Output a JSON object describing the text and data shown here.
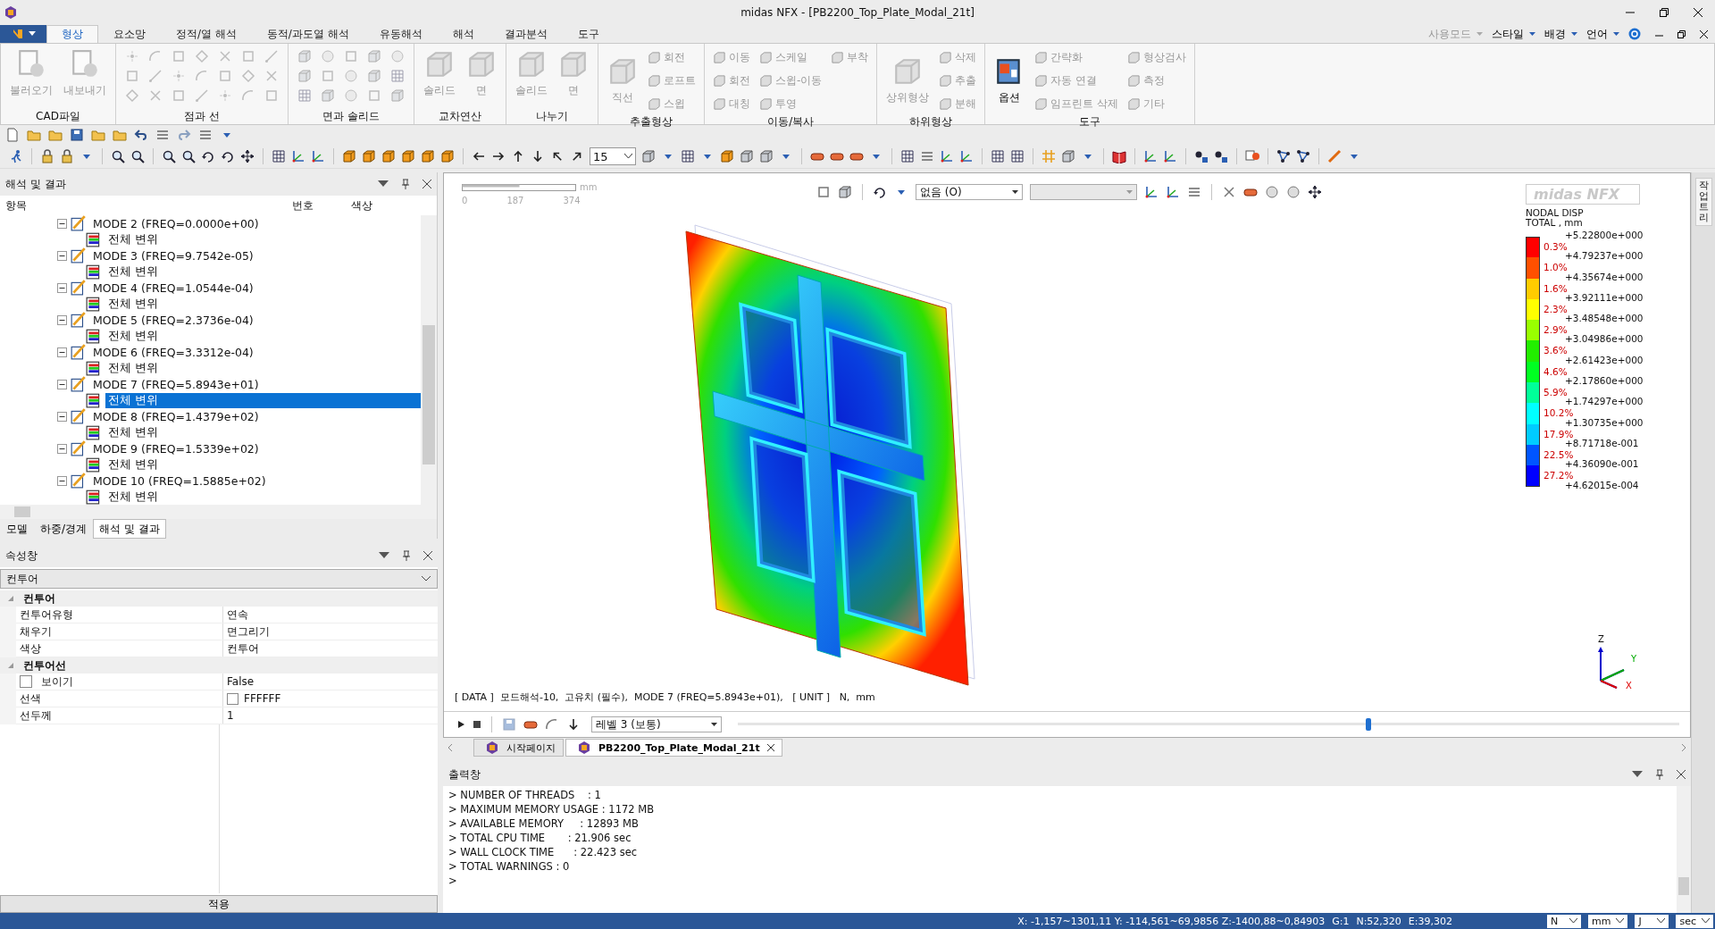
{
  "window": {
    "title": "midas NFX - [PB2200_Top_Plate_Modal_21t]"
  },
  "ribbon_tabs": [
    {
      "label": "형상",
      "selected": true
    },
    {
      "label": "요소망",
      "selected": false
    },
    {
      "label": "정적/열 해석",
      "selected": false
    },
    {
      "label": "동적/과도열 해석",
      "selected": false
    },
    {
      "label": "유동해석",
      "selected": false
    },
    {
      "label": "해석",
      "selected": false
    },
    {
      "label": "결과분석",
      "selected": false
    },
    {
      "label": "도구",
      "selected": false
    }
  ],
  "ribbon_right": [
    {
      "label": "사용모드",
      "disabled": true
    },
    {
      "label": "스타일",
      "disabled": false
    },
    {
      "label": "배경",
      "disabled": false
    },
    {
      "label": "언어",
      "disabled": false
    }
  ],
  "ribbon_groups": [
    {
      "title": "CAD파일",
      "items": [
        {
          "kind": "large",
          "label": "불러오기",
          "disabled": true
        },
        {
          "kind": "large",
          "label": "내보내기",
          "disabled": true
        }
      ]
    },
    {
      "title": "점과 선",
      "items": [
        {
          "kind": "icon_grid",
          "disabled": true
        }
      ]
    },
    {
      "title": "면과 솔리드",
      "items": [
        {
          "kind": "icon_grid",
          "disabled": true
        }
      ]
    },
    {
      "title": "교차연산",
      "items": [
        {
          "kind": "large",
          "label": "솔리드",
          "disabled": true
        },
        {
          "kind": "large",
          "label": "면",
          "disabled": true
        }
      ]
    },
    {
      "title": "나누기",
      "items": [
        {
          "kind": "large",
          "label": "솔리드",
          "disabled": true
        },
        {
          "kind": "large",
          "label": "면",
          "disabled": true
        }
      ]
    },
    {
      "title": "추출형상",
      "items": [
        {
          "kind": "large",
          "label": "직선",
          "disabled": true
        },
        {
          "kind": "small",
          "label": "회전",
          "disabled": true
        },
        {
          "kind": "small",
          "label": "로프트",
          "disabled": true
        },
        {
          "kind": "small",
          "label": "스윕",
          "disabled": true
        }
      ]
    },
    {
      "title": "이동/복사",
      "items": [
        {
          "kind": "small",
          "label": "이동",
          "disabled": true
        },
        {
          "kind": "small",
          "label": "회전",
          "disabled": true
        },
        {
          "kind": "small",
          "label": "대칭",
          "disabled": true
        },
        {
          "kind": "small",
          "label": "스케일",
          "disabled": true
        },
        {
          "kind": "small",
          "label": "스윕-이동",
          "disabled": true
        },
        {
          "kind": "small",
          "label": "투영",
          "disabled": true
        },
        {
          "kind": "small",
          "label": "부착",
          "disabled": true
        }
      ]
    },
    {
      "title": "하위형상",
      "items": [
        {
          "kind": "large",
          "label": "상위형상",
          "disabled": true
        },
        {
          "kind": "small",
          "label": "삭제",
          "disabled": true
        },
        {
          "kind": "small",
          "label": "추출",
          "disabled": true
        },
        {
          "kind": "small",
          "label": "분해",
          "disabled": true
        }
      ]
    },
    {
      "title": "도구",
      "items": [
        {
          "kind": "large",
          "label": "옵션",
          "disabled": false
        },
        {
          "kind": "small",
          "label": "간략화",
          "disabled": true
        },
        {
          "kind": "small",
          "label": "자동 연결",
          "disabled": true
        },
        {
          "kind": "small",
          "label": "임프린트 삭제",
          "disabled": true
        },
        {
          "kind": "small",
          "label": "형상검사",
          "disabled": true
        },
        {
          "kind": "small",
          "label": "측정",
          "disabled": true
        },
        {
          "kind": "small",
          "label": "기타",
          "disabled": true
        }
      ]
    }
  ],
  "toolbar": {
    "view_step": "15"
  },
  "analysis_panel": {
    "title": "해석 및 결과",
    "columns": [
      "항목",
      "번호",
      "색상"
    ],
    "tree": [
      {
        "label": "MODE 2 (FREQ=0.0000e+00)",
        "selected": false,
        "expanded": true,
        "children": [
          {
            "label": "전체 변위",
            "selected": false
          }
        ]
      },
      {
        "label": "MODE 3 (FREQ=9.7542e-05)",
        "selected": false,
        "expanded": true,
        "children": [
          {
            "label": "전체 변위",
            "selected": false
          }
        ]
      },
      {
        "label": "MODE 4 (FREQ=1.0544e-04)",
        "selected": false,
        "expanded": true,
        "children": [
          {
            "label": "전체 변위",
            "selected": false
          }
        ]
      },
      {
        "label": "MODE 5 (FREQ=2.3736e-04)",
        "selected": false,
        "expanded": true,
        "children": [
          {
            "label": "전체 변위",
            "selected": false
          }
        ]
      },
      {
        "label": "MODE 6 (FREQ=3.3312e-04)",
        "selected": false,
        "expanded": true,
        "children": [
          {
            "label": "전체 변위",
            "selected": false
          }
        ]
      },
      {
        "label": "MODE 7 (FREQ=5.8943e+01)",
        "selected": false,
        "expanded": true,
        "children": [
          {
            "label": "전체 변위",
            "selected": true
          }
        ]
      },
      {
        "label": "MODE 8 (FREQ=1.4379e+02)",
        "selected": false,
        "expanded": true,
        "children": [
          {
            "label": "전체 변위",
            "selected": false
          }
        ]
      },
      {
        "label": "MODE 9 (FREQ=1.5339e+02)",
        "selected": false,
        "expanded": true,
        "children": [
          {
            "label": "전체 변위",
            "selected": false
          }
        ]
      },
      {
        "label": "MODE 10 (FREQ=1.5885e+02)",
        "selected": false,
        "expanded": true,
        "children": [
          {
            "label": "전체 변위",
            "selected": false
          }
        ]
      }
    ],
    "tabs": [
      {
        "label": "모델",
        "selected": false
      },
      {
        "label": "하중/경계",
        "selected": false
      },
      {
        "label": "해석 및 결과",
        "selected": true
      }
    ]
  },
  "properties_panel": {
    "title": "속성창",
    "category": "컨투어",
    "groups": [
      {
        "title": "컨투어",
        "expanded": true,
        "rows": [
          {
            "kind": "text",
            "name": "컨투어유형",
            "value": "연속"
          },
          {
            "kind": "text",
            "name": "채우기",
            "value": "면그리기"
          },
          {
            "kind": "text",
            "name": "색상",
            "value": "컨투어"
          }
        ]
      },
      {
        "title": "컨투어선",
        "expanded": true,
        "rows": [
          {
            "kind": "checkbox",
            "name": "보이기",
            "checked": false,
            "value": "False"
          },
          {
            "kind": "color",
            "name": "선색",
            "color": "#ffffff",
            "value": "FFFFFF"
          },
          {
            "kind": "text",
            "name": "선두께",
            "value": "1"
          }
        ]
      }
    ],
    "apply_button": "적용"
  },
  "viewport": {
    "display_dropdown": "없음 (O)",
    "scale_bar": {
      "unit": "mm",
      "ticks": [
        "0",
        "187",
        "374"
      ]
    },
    "legend": {
      "logo": "midas NFX",
      "title": "NODAL DISP",
      "subtitle": "TOTAL , mm",
      "values": [
        "+5.22800e+000",
        "+4.79237e+000",
        "+4.35674e+000",
        "+3.92111e+000",
        "+3.48548e+000",
        "+3.04986e+000",
        "+2.61423e+000",
        "+2.17860e+000",
        "+1.74297e+000",
        "+1.30735e+000",
        "+8.71718e-001",
        "+4.36090e-001",
        "+4.62015e-004"
      ],
      "bands": [
        {
          "color": "#ff0000",
          "percent": "0.3%"
        },
        {
          "color": "#ff5000",
          "percent": "1.0%"
        },
        {
          "color": "#ffcc00",
          "percent": "1.6%"
        },
        {
          "color": "#ffff00",
          "percent": "2.3%"
        },
        {
          "color": "#99ff00",
          "percent": "2.9%"
        },
        {
          "color": "#22ee00",
          "percent": "3.6%"
        },
        {
          "color": "#00ff22",
          "percent": "4.6%"
        },
        {
          "color": "#00ff99",
          "percent": "5.9%"
        },
        {
          "color": "#00ffff",
          "percent": "10.2%"
        },
        {
          "color": "#00ccff",
          "percent": "17.9%"
        },
        {
          "color": "#0055ff",
          "percent": "22.5%"
        },
        {
          "color": "#0000ff",
          "percent": "27.2%"
        }
      ]
    },
    "axes": [
      "Z",
      "Y",
      "X"
    ],
    "data_line": "[ DATA ]  모드해석-10,  고유치 (필수),  MODE 7 (FREQ=5.8943e+01),   [ UNIT ]   N,  mm",
    "animation": {
      "level_dropdown": "레벨 3 (보통)",
      "slider": {
        "level": 0.67
      }
    }
  },
  "document_tabs": [
    {
      "label": "시작페이지",
      "selected": false
    },
    {
      "label": "PB2200_Top_Plate_Modal_21t",
      "selected": true
    }
  ],
  "output": {
    "title": "출력창",
    "lines": [
      "> NUMBER OF THREADS    : 1",
      "> MAXIMUM MEMORY USAGE : 1172 MB",
      "> AVAILABLE MEMORY     : 12893 MB",
      "> TOTAL CPU TIME       : 21.906 sec",
      "> WALL CLOCK TIME      : 22.423 sec",
      "> TOTAL WARNINGS : 0",
      ">"
    ]
  },
  "side_tab": "작업트리",
  "status_bar": {
    "coords": "X: -1,157~1301,11 Y: -114,561~69,9856 Z:-1400,88~0,84903",
    "group": "G:1",
    "nodes": "N:52,320",
    "elements": "E:39,302",
    "units": [
      "N",
      "mm",
      "J",
      "sec"
    ]
  }
}
